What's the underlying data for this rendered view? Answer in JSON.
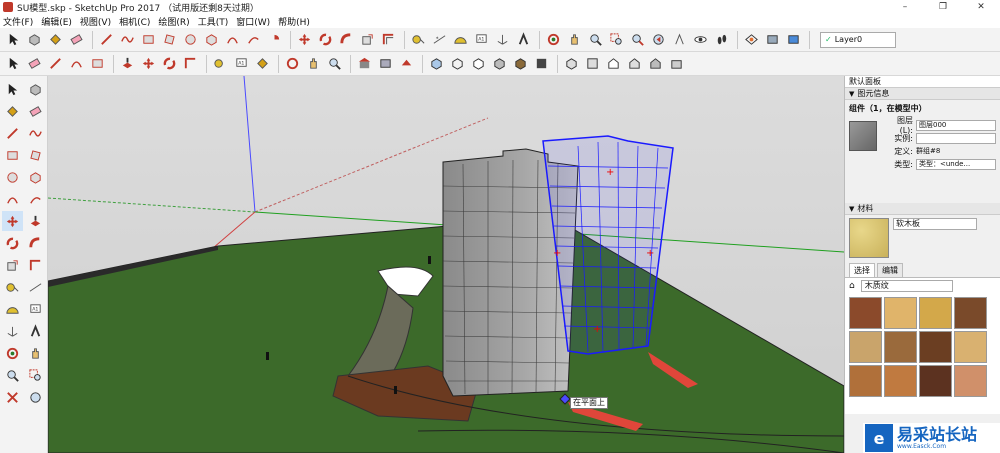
{
  "window": {
    "title": "SU模型.skp - SketchUp Pro 2017 （试用版还剩8天过期）",
    "min": "–",
    "max": "❐",
    "close": "✕"
  },
  "menu": [
    "文件(F)",
    "编辑(E)",
    "视图(V)",
    "相机(C)",
    "绘图(R)",
    "工具(T)",
    "窗口(W)",
    "帮助(H)"
  ],
  "layer_selector": {
    "value": "Layer0"
  },
  "viewport": {
    "inference_tooltip": "在平面上"
  },
  "panel": {
    "title": "默认面板",
    "entity_info": {
      "header": "图元信息",
      "name": "组件（1，在模型中）",
      "layer_label": "图层(L):",
      "layer_value": "图层000",
      "instance_label": "实例:",
      "instance_value": "",
      "definition_label": "定义:",
      "definition_value": "群组#8",
      "type_label": "类型:",
      "type_value": "类型：<unde..."
    },
    "materials": {
      "header": "材料",
      "current_name": "软木板",
      "tabs": [
        "选择",
        "编辑"
      ],
      "library": "木质纹",
      "textures": [
        "#8b4a2b",
        "#e0b46a",
        "#d3a84a",
        "#7a4a2a",
        "#c9a46b",
        "#9a6a3c",
        "#6b3e22",
        "#d9b170",
        "#b0703a",
        "#c07a40",
        "#5c3220",
        "#d0906a"
      ]
    }
  },
  "watermark": {
    "logo": "e",
    "text": "易采站长站",
    "sub": "www.Easck.Com"
  },
  "colors": {
    "selected": "#1a1aff",
    "grass": "#3c6a2a",
    "sky": "#d8d8d8"
  }
}
